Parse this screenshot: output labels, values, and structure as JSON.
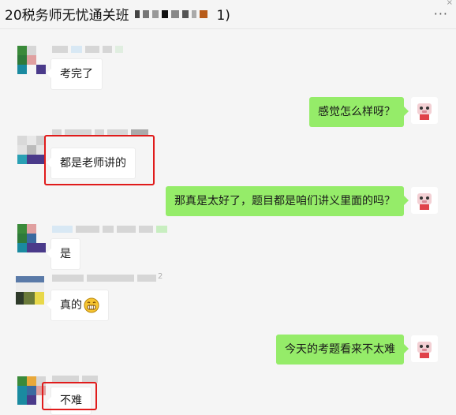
{
  "header": {
    "title": "20税务师无忧通关班",
    "title_suffix": "1)",
    "more_icon": "more-icon",
    "close_icon": "close-icon"
  },
  "messages": [
    {
      "side": "left",
      "text": "考完了",
      "highlighted": false
    },
    {
      "side": "right",
      "text": "感觉怎么样呀？",
      "highlighted": false
    },
    {
      "side": "left",
      "text": "都是老师讲的",
      "highlighted": true
    },
    {
      "side": "right",
      "text": "那真是太好了，题目都是咱们讲义里面的吗？",
      "highlighted": false
    },
    {
      "side": "left",
      "text": "是",
      "highlighted": false
    },
    {
      "side": "left",
      "text": "真的",
      "emoji": "grinning-face-emoji",
      "highlighted": false
    },
    {
      "side": "right",
      "text": "今天的考题看来不太难",
      "highlighted": false
    },
    {
      "side": "left",
      "text": "不难",
      "highlighted": true
    }
  ],
  "fragments": {
    "sender_4_name_tail": "2"
  },
  "colors": {
    "self_bubble": "#95ec69",
    "other_bubble": "#ffffff",
    "highlight": "#e01b1b",
    "background": "#f5f5f5"
  }
}
